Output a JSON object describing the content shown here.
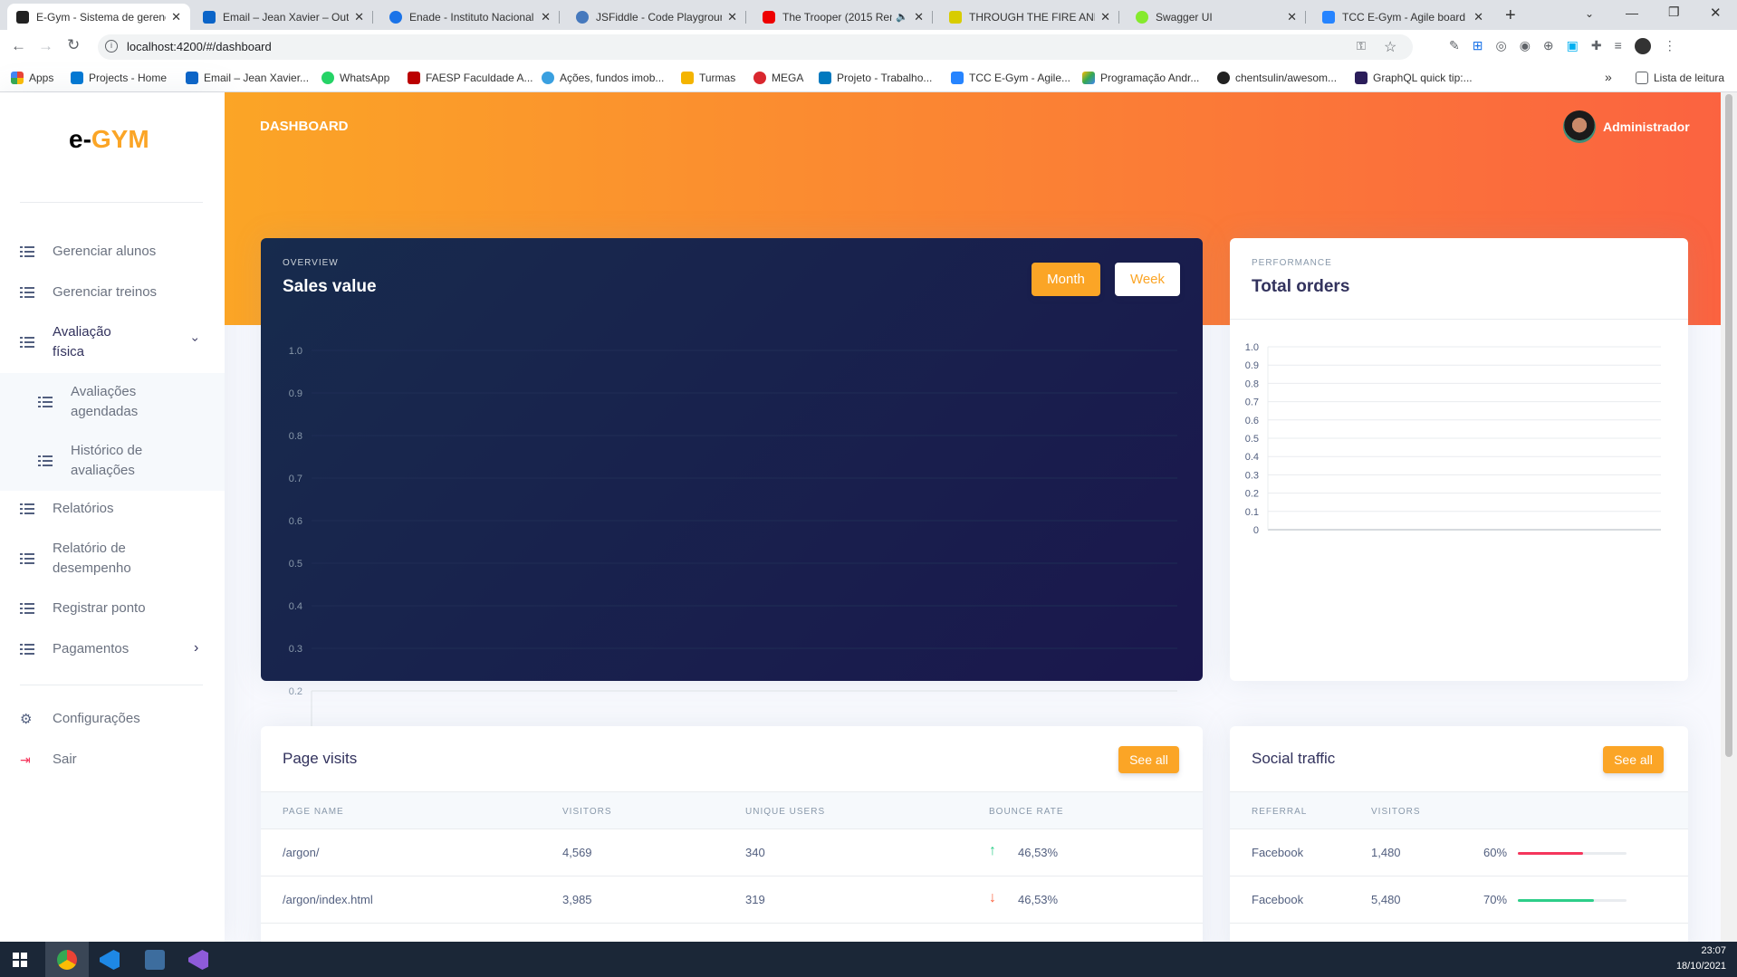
{
  "browser": {
    "tabs": [
      {
        "label": "E-Gym - Sistema de gerenc",
        "active": true
      },
      {
        "label": "Email – Jean Xavier – Outlo"
      },
      {
        "label": "Enade - Instituto Nacional"
      },
      {
        "label": "JSFiddle - Code Playgroun"
      },
      {
        "label": "The Trooper (2015 Rem"
      },
      {
        "label": "THROUGH THE FIRE AND"
      },
      {
        "label": "Swagger UI"
      },
      {
        "label": "TCC E-Gym - Agile board -"
      }
    ],
    "new_tab": "+",
    "url": "localhost:4200/#/dashboard",
    "bookmarks": [
      "Apps",
      "Projects - Home",
      "Email – Jean Xavier...",
      "WhatsApp",
      "FAESP Faculdade A...",
      "Ações, fundos imob...",
      "Turmas",
      "MEGA",
      "Projeto - Trabalho...",
      "TCC E-Gym - Agile...",
      "Programação Andr...",
      "chentsulin/awesom...",
      "GraphQL quick tip:..."
    ],
    "reading_list": "Lista de leitura",
    "more_bookmarks": "»"
  },
  "sidebar": {
    "logo_a": "e-",
    "logo_b": "GYM",
    "items": [
      {
        "label": "Gerenciar alunos"
      },
      {
        "label": "Gerenciar treinos"
      },
      {
        "label": "Avaliação física"
      },
      {
        "label": "Avaliações agendadas"
      },
      {
        "label": "Histórico de avaliações"
      },
      {
        "label": "Relatórios"
      },
      {
        "label": "Relatório de desempenho"
      },
      {
        "label": "Registrar ponto"
      },
      {
        "label": "Pagamentos"
      }
    ],
    "settings": "Configurações",
    "logout": "Sair"
  },
  "header": {
    "title": "DASHBOARD",
    "user": "Administrador"
  },
  "sales": {
    "overline": "OVERVIEW",
    "title": "Sales value",
    "btn_month": "Month",
    "btn_week": "Week"
  },
  "orders": {
    "overline": "PERFORMANCE",
    "title": "Total orders"
  },
  "chart_data": [
    {
      "type": "line",
      "yticks": [
        "1.0",
        "0.9",
        "0.8",
        "0.7",
        "0.6",
        "0.5",
        "0.4",
        "0.3",
        "0.2"
      ],
      "series": []
    },
    {
      "type": "bar",
      "yticks": [
        "1.0",
        "0.9",
        "0.8",
        "0.7",
        "0.6",
        "0.5",
        "0.4",
        "0.3",
        "0.2",
        "0.1",
        "0"
      ],
      "ylim": [
        0,
        1
      ],
      "series": []
    }
  ],
  "visits": {
    "title": "Page visits",
    "see_all": "See all",
    "headers": [
      "PAGE NAME",
      "VISITORS",
      "UNIQUE USERS",
      "BOUNCE RATE"
    ],
    "rows": [
      {
        "page": "/argon/",
        "visitors": "4,569",
        "unique": "340",
        "bounce": "46,53%",
        "trend": "up"
      },
      {
        "page": "/argon/index.html",
        "visitors": "3,985",
        "unique": "319",
        "bounce": "46,53%",
        "trend": "down"
      }
    ]
  },
  "social": {
    "title": "Social traffic",
    "see_all": "See all",
    "headers": [
      "REFERRAL",
      "VISITORS"
    ],
    "rows": [
      {
        "referral": "Facebook",
        "visitors": "1,480",
        "pct": "60%",
        "value": 0.6,
        "color": "#f5365c"
      },
      {
        "referral": "Facebook",
        "visitors": "5,480",
        "pct": "70%",
        "value": 0.7,
        "color": "#2dce89"
      }
    ]
  },
  "taskbar": {
    "time": "23:07",
    "date": "18/10/2021"
  },
  "colors": {
    "accent": "#fba526",
    "gradient_end": "#fb6340",
    "dark_card": "#172b4d"
  }
}
